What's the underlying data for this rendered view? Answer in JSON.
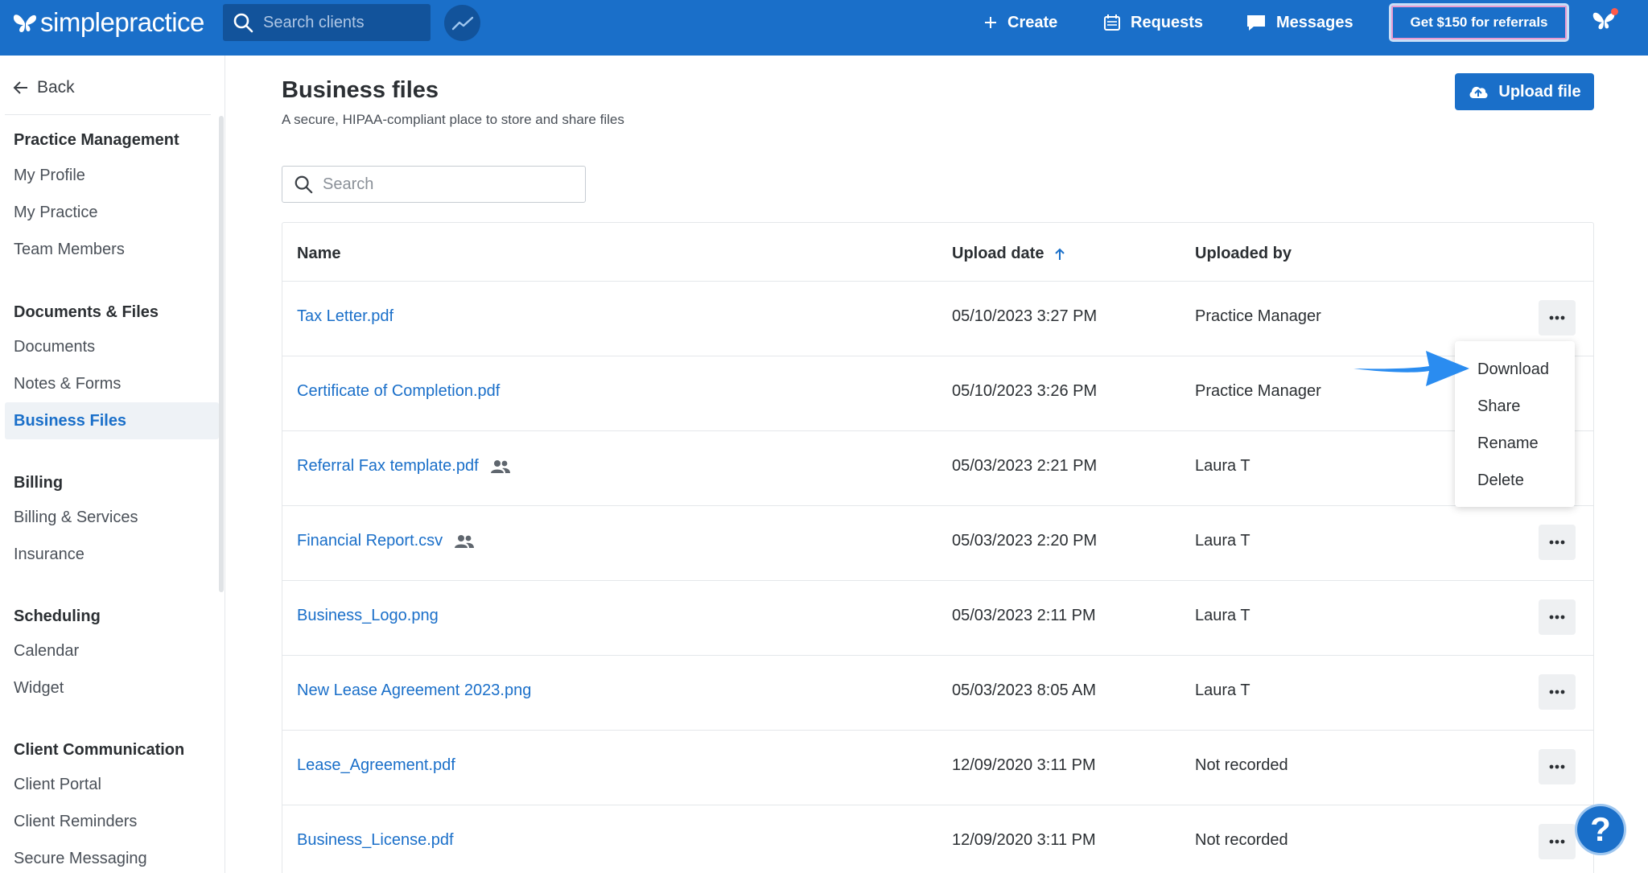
{
  "nav": {
    "logo_text": "simplepractice",
    "search_placeholder": "Search clients",
    "create": "Create",
    "requests": "Requests",
    "messages": "Messages",
    "referral": "Get $150 for referrals",
    "brand_color": "#1a6fc9"
  },
  "sidebar": {
    "back": "Back",
    "sections": [
      {
        "title": "Practice Management",
        "items": [
          "My Profile",
          "My Practice",
          "Team Members"
        ]
      },
      {
        "title": "Documents & Files",
        "items": [
          "Documents",
          "Notes & Forms",
          "Business Files"
        ]
      },
      {
        "title": "Billing",
        "items": [
          "Billing & Services",
          "Insurance"
        ]
      },
      {
        "title": "Scheduling",
        "items": [
          "Calendar",
          "Widget"
        ]
      },
      {
        "title": "Client Communication",
        "items": [
          "Client Portal",
          "Client Reminders",
          "Secure Messaging"
        ]
      }
    ],
    "active_item": "Business Files"
  },
  "main": {
    "title": "Business files",
    "subtitle": "A secure, HIPAA-compliant place to store and share files",
    "upload_label": "Upload file",
    "search_placeholder": "Search",
    "columns": {
      "name": "Name",
      "date": "Upload date",
      "by": "Uploaded by"
    },
    "rows": [
      {
        "name": "Tax Letter.pdf",
        "date": "05/10/2023 3:27 PM",
        "by": "Practice Manager",
        "shared": false
      },
      {
        "name": "Certificate of Completion.pdf",
        "date": "05/10/2023 3:26 PM",
        "by": "Practice Manager",
        "shared": false
      },
      {
        "name": "Referral Fax template.pdf",
        "date": "05/03/2023 2:21 PM",
        "by": "Laura T",
        "shared": true
      },
      {
        "name": "Financial Report.csv",
        "date": "05/03/2023 2:20 PM",
        "by": "Laura T",
        "shared": true
      },
      {
        "name": "Business_Logo.png",
        "date": "05/03/2023 2:11 PM",
        "by": "Laura T",
        "shared": false
      },
      {
        "name": "New Lease Agreement 2023.png",
        "date": "05/03/2023 8:05 AM",
        "by": "Laura T",
        "shared": false
      },
      {
        "name": "Lease_Agreement.pdf",
        "date": "12/09/2020 3:11 PM",
        "by": "Not recorded",
        "shared": false
      },
      {
        "name": "Business_License.pdf",
        "date": "12/09/2020 3:11 PM",
        "by": "Not recorded",
        "shared": false
      }
    ],
    "menu": [
      "Download",
      "Share",
      "Rename",
      "Delete"
    ],
    "help": "?"
  }
}
